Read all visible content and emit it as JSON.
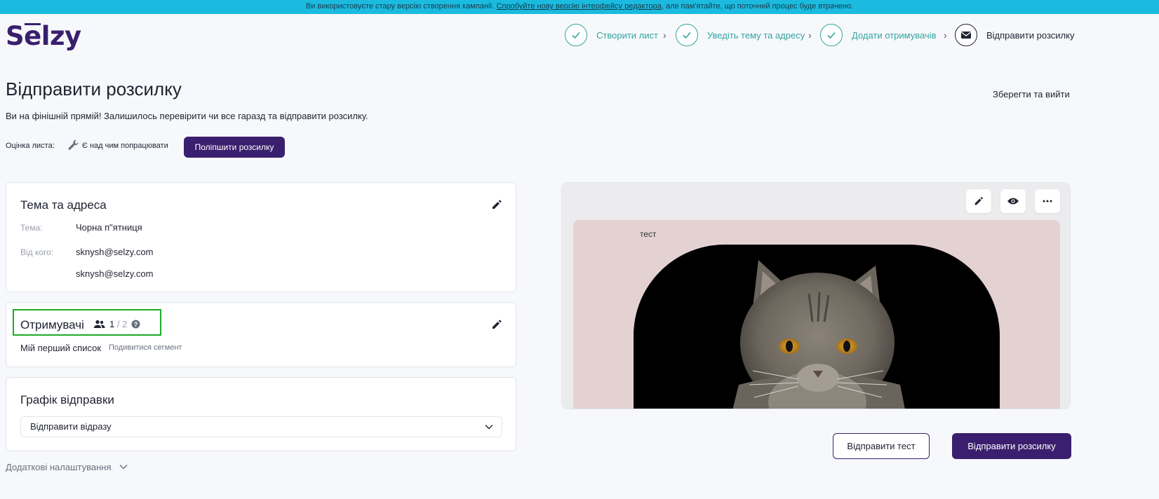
{
  "banner": {
    "text_before": "Ви використовуєте стару версію створення кампанії.",
    "link": "Спробуйте нову версію інтерфейсу редактора",
    "text_after": ", але пам'ятайте, що поточний процес буде втрачено."
  },
  "logo": {
    "part1": "S",
    "accent": "e",
    "part2": "lzy"
  },
  "steps": [
    {
      "label": "Створити лист",
      "status": "done"
    },
    {
      "label": "Уведіть тему та адресу",
      "status": "done"
    },
    {
      "label": "Додати отримувачів",
      "status": "done"
    },
    {
      "label": "Відправити розсилку",
      "status": "current"
    }
  ],
  "page": {
    "title": "Відправити розсилку",
    "subtitle": "Ви на фінішній прямій! Залишилось перевірити чи все гаразд та відправити розсилку.",
    "save_exit": "Зберегти та вийти"
  },
  "rating": {
    "label": "Оцінка листа:",
    "status": "Є над чим попрацювати",
    "improve_button": "Поліпшити розсилку"
  },
  "subject_card": {
    "title": "Тема та адреса",
    "subject_label": "Тема:",
    "subject_value": "Чорна п\"ятниця",
    "from_label": "Від кого:",
    "from_value": "sknysh@selzy.com",
    "reply_value": "sknysh@selzy.com"
  },
  "recipients_card": {
    "title": "Отримувачі",
    "count_current": "1",
    "count_sep": "/",
    "count_total": "2",
    "list_name": "Мій перший список",
    "segment_link": "Подивитися сегмент"
  },
  "schedule_card": {
    "title": "Графік відправки",
    "select_value": "Відправити відразу"
  },
  "more_settings": "Додаткові налаштування",
  "preview": {
    "email_text": "тест"
  },
  "actions": {
    "send_test": "Відправити тест",
    "send": "Відправити розсилку"
  },
  "colors": {
    "brand": "#3a1f6e",
    "banner": "#1bbbe0",
    "step_done": "#31a5a0",
    "highlight": "#1faa2a"
  }
}
